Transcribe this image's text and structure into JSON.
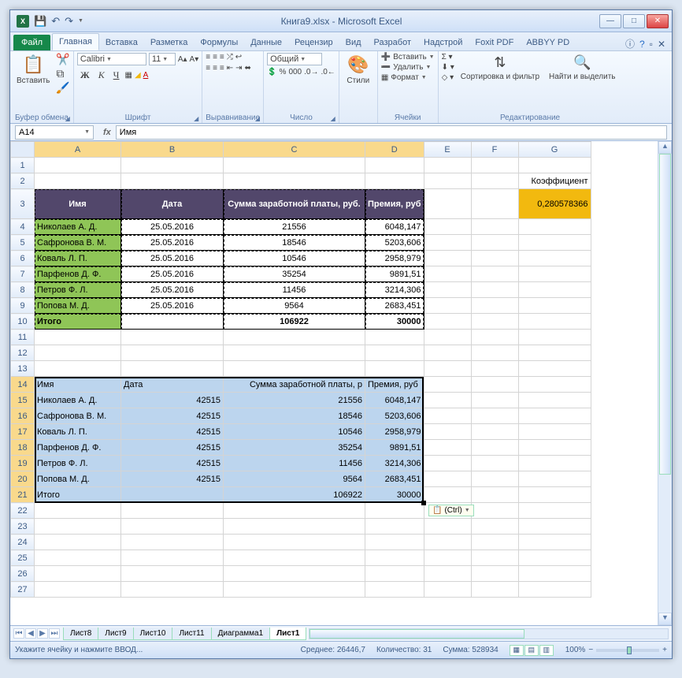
{
  "title": "Книга9.xlsx - Microsoft Excel",
  "qat": {
    "excel": "X"
  },
  "ribbonTabs": {
    "file": "Файл",
    "items": [
      "Главная",
      "Вставка",
      "Разметка",
      "Формулы",
      "Данные",
      "Рецензир",
      "Вид",
      "Разработ",
      "Надстрой",
      "Foxit PDF",
      "ABBYY PD"
    ],
    "active": 0
  },
  "ribbon": {
    "clipboard": {
      "paste": "Вставить",
      "label": "Буфер обмена"
    },
    "font": {
      "name": "Calibri",
      "size": "11",
      "label": "Шрифт"
    },
    "align": {
      "label": "Выравнивание"
    },
    "number": {
      "format": "Общий",
      "label": "Число"
    },
    "styles": {
      "btn": "Стили"
    },
    "cells": {
      "insert": "Вставить",
      "delete": "Удалить",
      "format": "Формат",
      "label": "Ячейки"
    },
    "editing": {
      "sort": "Сортировка и фильтр",
      "find": "Найти и выделить",
      "label": "Редактирование"
    }
  },
  "nameBox": "A14",
  "formula": "Имя",
  "columns": [
    "A",
    "B",
    "C",
    "D",
    "E",
    "F",
    "G"
  ],
  "coeff": {
    "label": "Коэффициент",
    "value": "0,280578366"
  },
  "table1": {
    "headers": {
      "name": "Имя",
      "date": "Дата",
      "sum": "Сумма заработной платы, руб.",
      "prem": "Премия, руб"
    },
    "rows": [
      {
        "name": "Николаев А. Д.",
        "date": "25.05.2016",
        "sum": "21556",
        "prem": "6048,147"
      },
      {
        "name": "Сафронова В. М.",
        "date": "25.05.2016",
        "sum": "18546",
        "prem": "5203,606"
      },
      {
        "name": "Коваль Л. П.",
        "date": "25.05.2016",
        "sum": "10546",
        "prem": "2958,979"
      },
      {
        "name": "Парфенов Д. Ф.",
        "date": "25.05.2016",
        "sum": "35254",
        "prem": "9891,51"
      },
      {
        "name": "Петров Ф. Л.",
        "date": "25.05.2016",
        "sum": "11456",
        "prem": "3214,306"
      },
      {
        "name": "Попова М. Д.",
        "date": "25.05.2016",
        "sum": "9564",
        "prem": "2683,451"
      }
    ],
    "total": {
      "name": "Итого",
      "sum": "106922",
      "prem": "30000"
    }
  },
  "table2": {
    "headers": {
      "name": "Имя",
      "date": "Дата",
      "sum": "Сумма заработной платы, р",
      "prem": "Премия, руб"
    },
    "rows": [
      {
        "name": "Николаев А. Д.",
        "date": "42515",
        "sum": "21556",
        "prem": "6048,147"
      },
      {
        "name": "Сафронова В. М.",
        "date": "42515",
        "sum": "18546",
        "prem": "5203,606"
      },
      {
        "name": "Коваль Л. П.",
        "date": "42515",
        "sum": "10546",
        "prem": "2958,979"
      },
      {
        "name": "Парфенов Д. Ф.",
        "date": "42515",
        "sum": "35254",
        "prem": "9891,51"
      },
      {
        "name": "Петров Ф. Л.",
        "date": "42515",
        "sum": "11456",
        "prem": "3214,306"
      },
      {
        "name": "Попова М. Д.",
        "date": "42515",
        "sum": "9564",
        "prem": "2683,451"
      }
    ],
    "total": {
      "name": "Итого",
      "sum": "106922",
      "prem": "30000"
    }
  },
  "pasteOptions": "(Ctrl)",
  "sheetTabs": [
    "Лист8",
    "Лист9",
    "Лист10",
    "Лист11",
    "Диаграмма1",
    "Лист1"
  ],
  "activeSheet": 5,
  "status": {
    "msg": "Укажите ячейку и нажмите ВВОД...",
    "avg": "Среднее: 26446,7",
    "count": "Количество: 31",
    "sum": "Сумма: 528934",
    "zoom": "100%"
  }
}
